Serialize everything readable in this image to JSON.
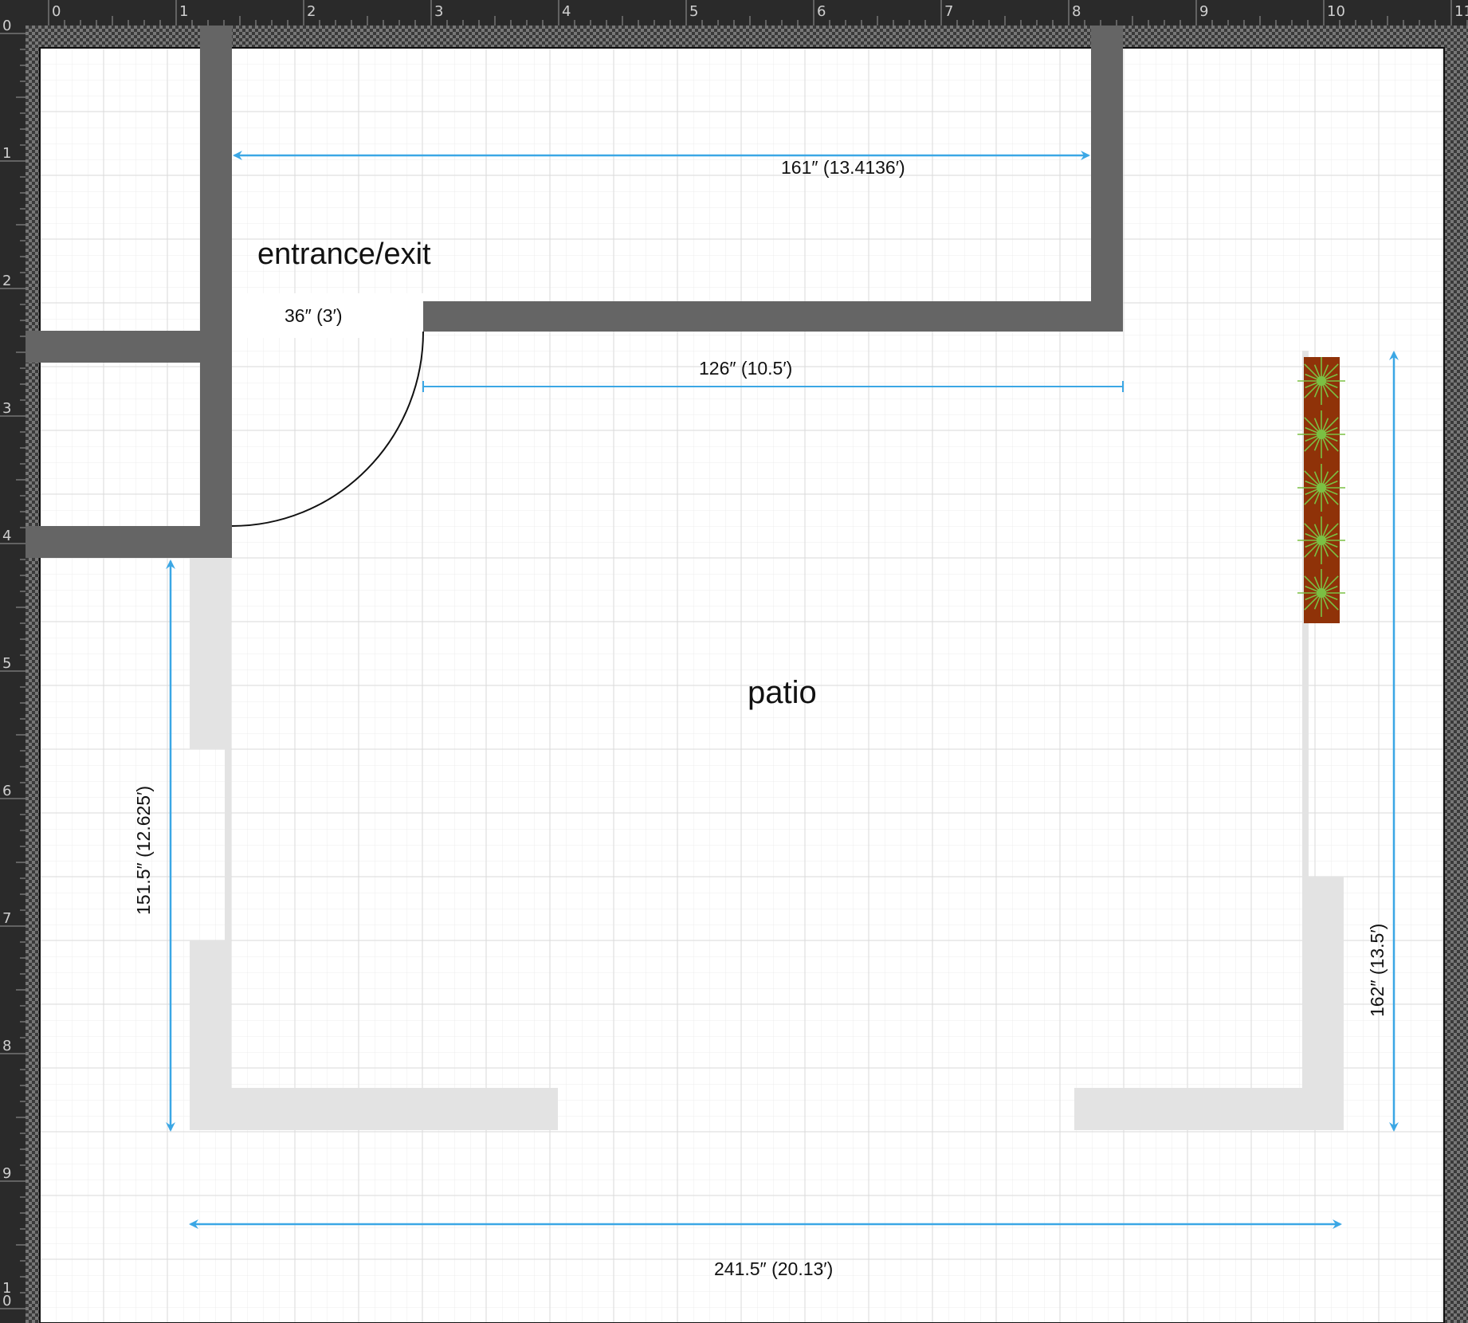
{
  "rulers": {
    "horizontal_labels": [
      "0",
      "1",
      "2",
      "3",
      "4",
      "5",
      "6",
      "7",
      "8",
      "9",
      "10",
      "11"
    ],
    "vertical_labels": [
      "0",
      "1",
      "2",
      "3",
      "4",
      "5",
      "6",
      "7",
      "8",
      "9",
      "10"
    ]
  },
  "labels": {
    "entrance": "entrance/exit",
    "patio": "patio"
  },
  "dimensions": {
    "top_wall": "161″ (13.4136′)",
    "door_width": "36″ (3′)",
    "inner_wall": "126″ (10.5′)",
    "left_height": "151.5″ (12.625′)",
    "right_height": "162″ (13.5′)",
    "bottom_width": "241.5″ (20.13′)"
  },
  "colors": {
    "wall": "#656565",
    "fence": "#e3e3e3",
    "dimension_line": "#3ba7e5",
    "planter": "#8f3208",
    "plant": "#7bc043",
    "grid_minor": "#ededed",
    "grid_major": "#d7d7d7"
  },
  "icons": {
    "plant": "plant-icon",
    "door_swing": "door-swing-arc"
  }
}
